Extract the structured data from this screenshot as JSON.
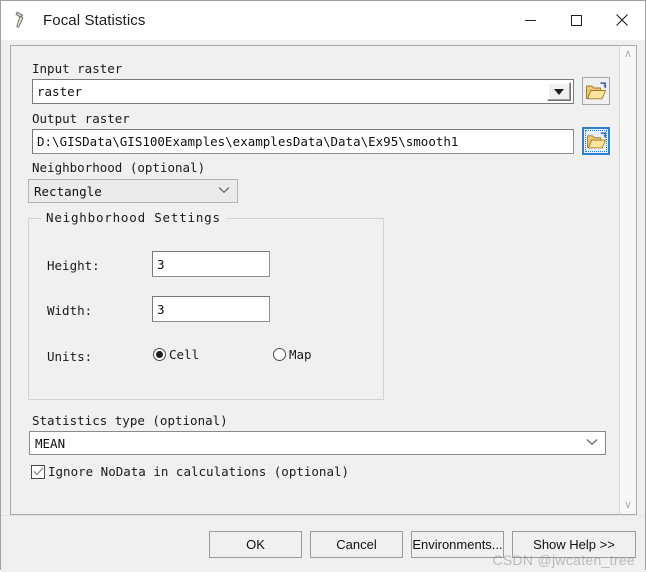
{
  "window": {
    "title": "Focal Statistics",
    "icon": "hammer-tool-icon",
    "controls": {
      "minimize": "─",
      "maximize": "☐",
      "close": "✕"
    }
  },
  "form": {
    "input_raster": {
      "label": "Input raster",
      "value": "raster",
      "browse_icon": "open-folder-icon"
    },
    "output_raster": {
      "label": "Output raster",
      "value": "D:\\GISData\\GIS100Examples\\examplesData\\Data\\Ex95\\smooth1",
      "browse_icon": "open-folder-icon"
    },
    "neighborhood": {
      "label": "Neighborhood (optional)",
      "value": "Rectangle"
    },
    "neighborhood_settings": {
      "title": "Neighborhood Settings",
      "height": {
        "label": "Height:",
        "value": "3"
      },
      "width": {
        "label": "Width:",
        "value": "3"
      },
      "units": {
        "label": "Units:",
        "options": [
          {
            "label": "Cell",
            "selected": true
          },
          {
            "label": "Map",
            "selected": false
          }
        ]
      }
    },
    "statistics_type": {
      "label": "Statistics type (optional)",
      "value": "MEAN"
    },
    "ignore_nodata": {
      "label": "Ignore NoData in calculations (optional)",
      "checked": true,
      "check_glyph": "✓"
    }
  },
  "scrollbar": {
    "up_arrow": "∧",
    "down_arrow": "∨"
  },
  "footer": {
    "ok": "OK",
    "cancel": "Cancel",
    "environments": "Environments...",
    "show_help": "Show Help >>"
  },
  "watermark": "CSDN @jwcaten_tree",
  "colors": {
    "dialog_bg": "#f0f0f0",
    "titlebar_bg": "#ffffff",
    "focus_blue": "#2f7fd1",
    "text": "#1a1a1a"
  }
}
